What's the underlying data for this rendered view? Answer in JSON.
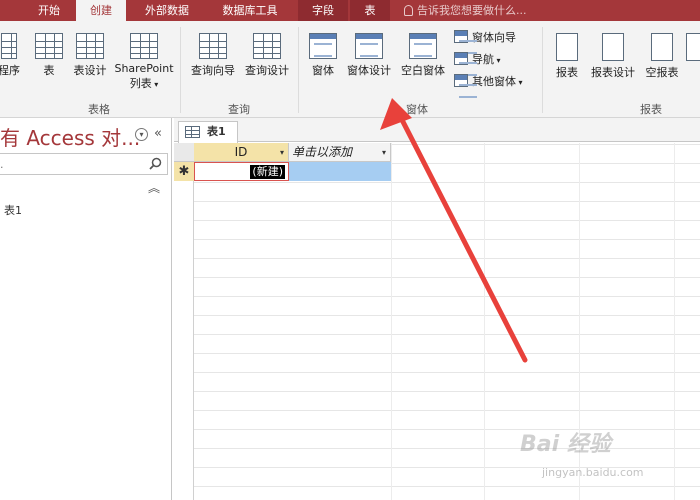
{
  "tabs": [
    {
      "label": "开始"
    },
    {
      "label": "创建"
    },
    {
      "label": "外部数据"
    },
    {
      "label": "数据库工具"
    },
    {
      "label": "字段"
    },
    {
      "label": "表"
    }
  ],
  "tell_me": "告诉我您想要做什么...",
  "ribbon": {
    "partial_left": "程序",
    "table_buttons": [
      "表",
      "表设计",
      "SharePoint",
      "列表"
    ],
    "table_group": "表格",
    "query_buttons": [
      "查询向导",
      "查询设计"
    ],
    "query_group": "查询",
    "form_buttons": [
      "窗体",
      "窗体设计",
      "空白窗体"
    ],
    "form_small": [
      "窗体向导",
      "导航",
      "其他窗体"
    ],
    "form_group": "窗体",
    "report_buttons": [
      "报表",
      "报表设计",
      "空报表"
    ],
    "report_group": "报表"
  },
  "nav": {
    "title": "有 Access 对...",
    "item": "表1"
  },
  "doc": {
    "tab_label": "表1",
    "col_id": "ID",
    "col_add": "单击以添加",
    "new_row_marker": "✱",
    "new_cell": "(新建)"
  },
  "watermark": {
    "text": "Bai 经验",
    "url": "jingyan.baidu.com"
  },
  "colors": {
    "accent": "#a4373a",
    "selection": "#a6cdf2",
    "arrow": "#e8413b"
  }
}
